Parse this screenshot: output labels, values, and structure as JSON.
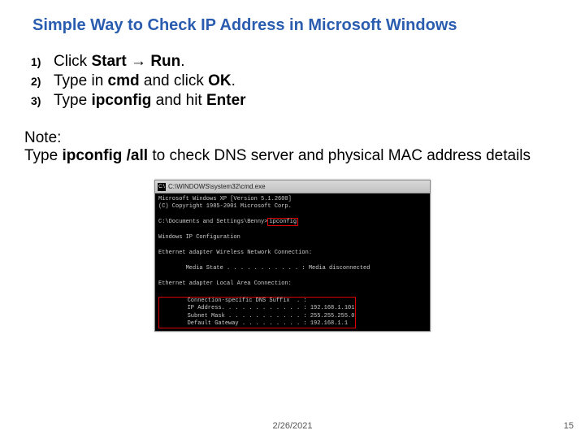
{
  "title": "Simple Way to Check IP Address in Microsoft Windows",
  "steps": [
    {
      "num": "1)",
      "pre": "Click ",
      "b1": "Start",
      "mid": " → ",
      "b2": "Run",
      "post": "."
    },
    {
      "num": "2)",
      "pre": "Type in ",
      "b1": "cmd",
      "mid": " and click ",
      "b2": "OK",
      "post": "."
    },
    {
      "num": "3)",
      "pre": "Type ",
      "b1": "ipconfig",
      "mid": " and hit ",
      "b2": "Enter",
      "post": ""
    }
  ],
  "note": {
    "label": "Note:",
    "pre": "Type ",
    "bold": "ipconfig /all",
    "post": " to check DNS server and physical MAC address details"
  },
  "cmd": {
    "title_prefix": "C:\\",
    "title": "C:\\WINDOWS\\system32\\cmd.exe",
    "line1": "Microsoft Windows XP [Version 5.1.2600]",
    "line2": "(C) Copyright 1985-2001 Microsoft Corp.",
    "prompt_line_pre": "C:\\Documents and Settings\\Benny>",
    "prompt_cmd": "ipconfig",
    "cfg_header": "Windows IP Configuration",
    "adapter_wireless": "Ethernet adapter Wireless Network Connection:",
    "media_state": "        Media State . . . . . . . . . . . : Media disconnected",
    "adapter_lan": "Ethernet adapter Local Area Connection:",
    "out_suffix": "        Connection-specific DNS Suffix  . :",
    "out_ip": "        IP Address. . . . . . . . . . . . : 192.168.1.101",
    "out_mask": "        Subnet Mask . . . . . . . . . . . : 255.255.255.0",
    "out_gw": "        Default Gateway . . . . . . . . . : 192.168.1.1"
  },
  "footer": {
    "date": "2/26/2021",
    "page": "15"
  }
}
